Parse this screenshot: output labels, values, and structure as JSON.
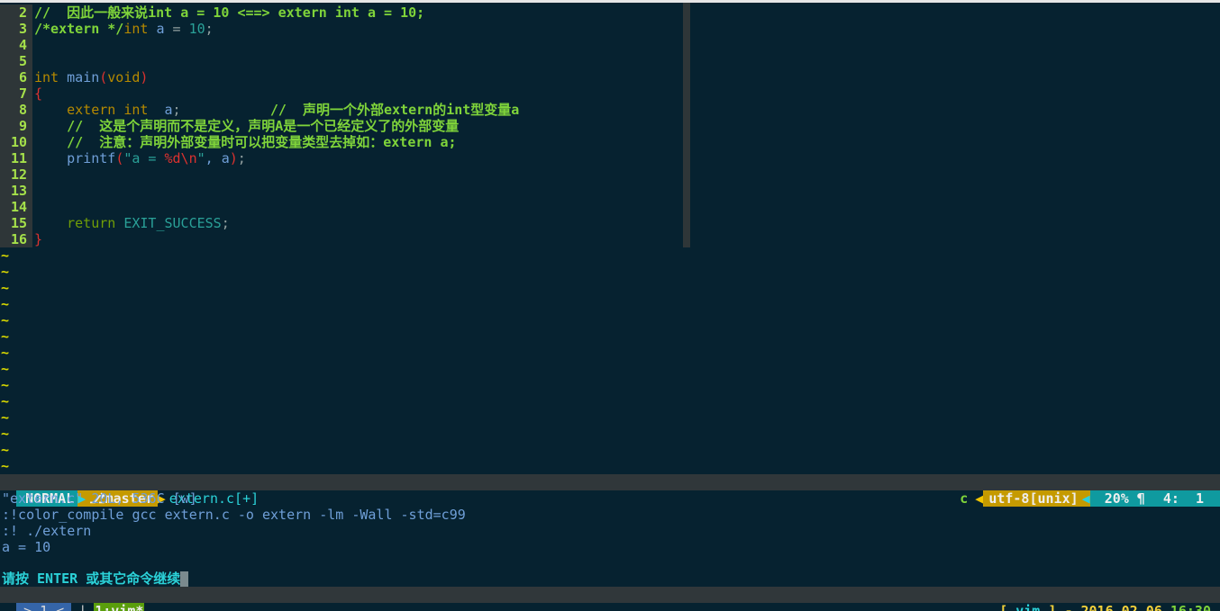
{
  "editor": {
    "lines": [
      {
        "n": "2",
        "segs": [
          {
            "t": "//  因此一般来说int a = 10 <==> extern int a = 10;",
            "c": "cm"
          }
        ]
      },
      {
        "n": "3",
        "segs": [
          {
            "t": "/*extern */",
            "c": "cm"
          },
          {
            "t": "int",
            "c": "ty"
          },
          {
            "t": " a ",
            "c": "id"
          },
          {
            "t": "=",
            "c": "op"
          },
          {
            "t": " 10",
            "c": "nu"
          },
          {
            "t": ";",
            "c": "op"
          }
        ]
      },
      {
        "n": "4",
        "segs": []
      },
      {
        "n": "5",
        "segs": []
      },
      {
        "n": "6",
        "segs": [
          {
            "t": "int",
            "c": "ty"
          },
          {
            "t": " main",
            "c": "fn"
          },
          {
            "t": "(",
            "c": "pa"
          },
          {
            "t": "void",
            "c": "ty"
          },
          {
            "t": ")",
            "c": "pa"
          }
        ]
      },
      {
        "n": "7",
        "segs": [
          {
            "t": "{",
            "c": "pa"
          }
        ]
      },
      {
        "n": "8",
        "segs": [
          {
            "t": "    extern int",
            "c": "ty"
          },
          {
            "t": "  a",
            "c": "id"
          },
          {
            "t": ";",
            "c": "op"
          },
          {
            "t": "           //  声明一个外部extern的int型变量a",
            "c": "cm"
          }
        ]
      },
      {
        "n": "9",
        "segs": [
          {
            "t": "    //  这是个声明而不是定义，声明A是一个已经定义了的外部变量",
            "c": "cm"
          }
        ]
      },
      {
        "n": "10",
        "segs": [
          {
            "t": "    //  注意：声明外部变量时可以把变量类型去掉如：extern a;",
            "c": "cm"
          }
        ]
      },
      {
        "n": "11",
        "segs": [
          {
            "t": "    printf",
            "c": "fn"
          },
          {
            "t": "(",
            "c": "pa"
          },
          {
            "t": "\"a = ",
            "c": "st"
          },
          {
            "t": "%d\\n",
            "c": "pa"
          },
          {
            "t": "\"",
            "c": "st"
          },
          {
            "t": ", a",
            "c": "id"
          },
          {
            "t": ")",
            "c": "pa"
          },
          {
            "t": ";",
            "c": "op"
          }
        ]
      },
      {
        "n": "12",
        "segs": []
      },
      {
        "n": "13",
        "segs": []
      },
      {
        "n": "14",
        "segs": []
      },
      {
        "n": "15",
        "segs": [
          {
            "t": "    return",
            "c": "rt"
          },
          {
            "t": " EXIT_SUCCESS",
            "c": "nu"
          },
          {
            "t": ";",
            "c": "op"
          }
        ]
      },
      {
        "n": "16",
        "segs": [
          {
            "t": "}",
            "c": "pa"
          }
        ]
      }
    ],
    "tilde": "~",
    "tilde_count": 14
  },
  "statusline": {
    "mode": "NORMAL",
    "branch": "⎇master",
    "file": "extern.c[+]",
    "filetype": "c",
    "encoding": "utf-8[unix]",
    "percent": "20% ¶",
    "position": "4:  1",
    "arrow_right": "▶",
    "arrow_left": "◀"
  },
  "messages": [
    "\"extern.c\" 20L, 536C [w]",
    ":!color_compile gcc extern.c -o extern -lm -Wall -std=c99",
    ":! ./extern",
    "a = 10"
  ],
  "prompt": "请按 ENTER 或其它命令继续",
  "tmux": {
    "session": "> 1 <",
    "separator": "|",
    "window": "1:vim*",
    "lb": "[",
    "app": "vim",
    "rb": "]",
    "dash": "-",
    "date": "2016.02.06",
    "time": "16:30"
  }
}
